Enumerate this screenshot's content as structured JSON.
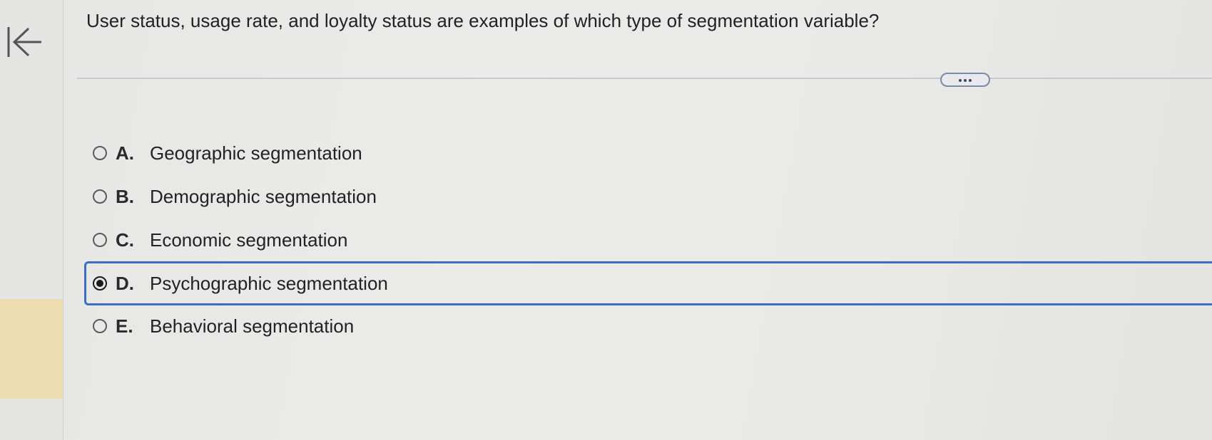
{
  "question": {
    "text": "User status, usage rate, and loyalty status are examples of which type of segmentation variable?"
  },
  "toolbar": {
    "collapse_icon": "collapse-left-icon",
    "more_icon": "ellipsis-icon"
  },
  "options": [
    {
      "letter": "A.",
      "text": "Geographic segmentation",
      "selected": false
    },
    {
      "letter": "B.",
      "text": "Demographic segmentation",
      "selected": false
    },
    {
      "letter": "C.",
      "text": "Economic segmentation",
      "selected": false
    },
    {
      "letter": "D.",
      "text": "Psychographic segmentation",
      "selected": true
    },
    {
      "letter": "E.",
      "text": "Behavioral segmentation",
      "selected": false
    }
  ],
  "colors": {
    "selection_border": "#3c6ec8",
    "rail_highlight": "#ecdcb0"
  }
}
